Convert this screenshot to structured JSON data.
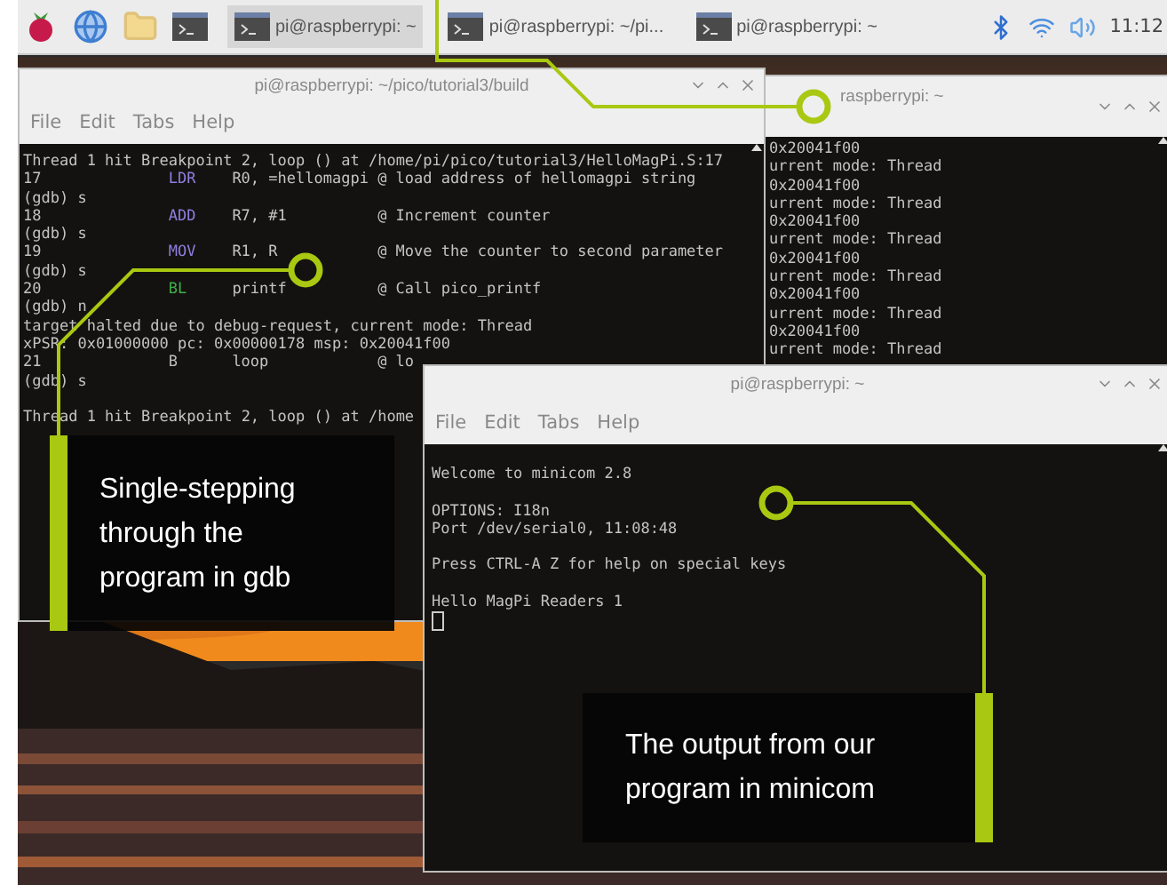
{
  "taskbar": {
    "tasks": [
      {
        "label": "pi@raspberrypi: ~",
        "selected": true
      },
      {
        "label": "pi@raspberrypi: ~/pi...",
        "selected": false
      },
      {
        "label": "pi@raspberrypi: ~",
        "selected": false
      }
    ],
    "clock": "11:12"
  },
  "gdb_window": {
    "title": "pi@raspberrypi: ~/pico/tutorial3/build",
    "menu": [
      "File",
      "Edit",
      "Tabs",
      "Help"
    ],
    "lines": [
      {
        "kind": "text",
        "text": "Thread 1 hit Breakpoint 2, loop () at /home/pi/pico/tutorial3/HelloMagPi.S:17"
      },
      {
        "kind": "code",
        "num": "17",
        "op": "LDR",
        "color": "#8f7fe0",
        "args": "R0, =hellomagpi",
        "comment": "@ load address of hellomagpi string"
      },
      {
        "kind": "text",
        "text": "(gdb) s"
      },
      {
        "kind": "code",
        "num": "18",
        "op": "ADD",
        "color": "#8f7fe0",
        "args": "R7, #1",
        "comment": "@ Increment counter"
      },
      {
        "kind": "text",
        "text": "(gdb) s"
      },
      {
        "kind": "code",
        "num": "19",
        "op": "MOV",
        "color": "#8f7fe0",
        "args": "R1, R",
        "comment": "@ Move the counter to second parameter"
      },
      {
        "kind": "text",
        "text": "(gdb) s"
      },
      {
        "kind": "code",
        "num": "20",
        "op": "BL",
        "color": "#3fae4a",
        "args": "printf",
        "comment": "@ Call pico_printf"
      },
      {
        "kind": "text",
        "text": "(gdb) n"
      },
      {
        "kind": "text",
        "text": "target halted due to debug-request, current mode: Thread"
      },
      {
        "kind": "text",
        "text": "xPSR: 0x01000000 pc: 0x00000178 msp: 0x20041f00"
      },
      {
        "kind": "code",
        "num": "21",
        "op": "B",
        "color": "#bdbdbd",
        "args": "loop",
        "comment": "@ lo"
      },
      {
        "kind": "text",
        "text": "(gdb) s"
      },
      {
        "kind": "blank"
      },
      {
        "kind": "text",
        "text": "Thread 1 hit Breakpoint 2, loop () at /home"
      }
    ]
  },
  "back_window": {
    "title": "raspberrypi: ~",
    "lines": [
      "0x20041f00",
      "urrent mode: Thread",
      "0x20041f00",
      "urrent mode: Thread",
      "0x20041f00",
      "urrent mode: Thread",
      "0x20041f00",
      "urrent mode: Thread",
      "0x20041f00",
      "urrent mode: Thread",
      "0x20041f00",
      "urrent mode: Thread"
    ]
  },
  "minicom_window": {
    "title": "pi@raspberrypi: ~",
    "menu": [
      "File",
      "Edit",
      "Tabs",
      "Help"
    ],
    "lines": [
      {
        "kind": "text",
        "text": "Welcome to minicom 2.8"
      },
      {
        "kind": "blank"
      },
      {
        "kind": "text",
        "text": "OPTIONS: I18n"
      },
      {
        "kind": "text",
        "text": "Port /dev/serial0, 11:08:48"
      },
      {
        "kind": "blank"
      },
      {
        "kind": "text",
        "text": "Press CTRL-A Z for help on special keys"
      },
      {
        "kind": "blank"
      },
      {
        "kind": "text",
        "text": "Hello MagPi Readers 1"
      },
      {
        "kind": "cursor"
      }
    ]
  },
  "callouts": [
    {
      "text": "Single-stepping through the program in gdb"
    },
    {
      "text": "The output from our program in minicom"
    }
  ]
}
